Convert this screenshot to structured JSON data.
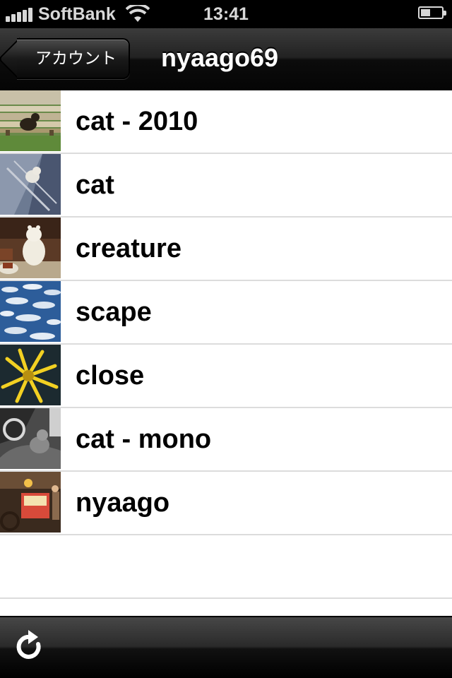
{
  "status_bar": {
    "carrier": "SoftBank",
    "time": "13:41",
    "signal_bars": 5,
    "battery_level": 0.45,
    "icons": [
      "signal-icon",
      "wifi-icon",
      "battery-icon"
    ]
  },
  "nav_bar": {
    "back_label": "アカウント",
    "title": "nyaago69"
  },
  "sets": [
    {
      "label": "cat - 2010",
      "thumb": "bench-cat-thumb"
    },
    {
      "label": "cat",
      "thumb": "cat-wall-thumb"
    },
    {
      "label": "creature",
      "thumb": "plush-toy-thumb"
    },
    {
      "label": "scape",
      "thumb": "cloud-sky-thumb"
    },
    {
      "label": "close",
      "thumb": "yellow-flower-thumb"
    },
    {
      "label": "cat - mono",
      "thumb": "mono-cat-thumb"
    },
    {
      "label": "nyaago",
      "thumb": "street-cart-thumb"
    }
  ],
  "toolbar": {
    "refresh_icon": "refresh-icon"
  },
  "colors": {
    "bar_dark": "#111111",
    "separator": "#dcdcdc",
    "text": "#000000"
  }
}
